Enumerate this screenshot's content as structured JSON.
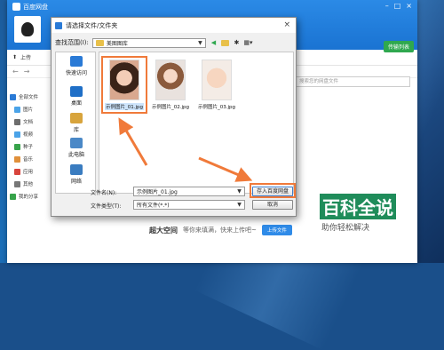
{
  "app": {
    "title": "百度网盘",
    "upload_label": "上传",
    "search_placeholder": "搜索您的网盘文件",
    "side_tag": "传输列表",
    "sidebar": [
      {
        "label": "全部文件",
        "color": "#2a7ad6",
        "sub": false
      },
      {
        "label": "图片",
        "color": "#4aa3e8",
        "sub": true
      },
      {
        "label": "文档",
        "color": "#6d6d6d",
        "sub": true
      },
      {
        "label": "视频",
        "color": "#4aa3e8",
        "sub": true
      },
      {
        "label": "种子",
        "color": "#37a34a",
        "sub": true
      },
      {
        "label": "音乐",
        "color": "#e0903a",
        "sub": true
      },
      {
        "label": "应用",
        "color": "#d8443c",
        "sub": true
      },
      {
        "label": "其他",
        "color": "#777777",
        "sub": true
      },
      {
        "label": "我的分享",
        "color": "#37a34a",
        "sub": false
      }
    ],
    "bottom_bold": "超大空间",
    "bottom_text": "等你来填满，快来上传吧~",
    "bottom_button": "上传文件"
  },
  "dialog": {
    "title": "请选择文件/文件夹",
    "lookin_label": "查找范围(I):",
    "lookin_value": "美图图库",
    "places": [
      {
        "label": "快速访问",
        "color": "#2a7ad6"
      },
      {
        "label": "桌面",
        "color": "#1f6fc7"
      },
      {
        "label": "库",
        "color": "#d8a43c"
      },
      {
        "label": "此电脑",
        "color": "#4a88c7"
      },
      {
        "label": "网络",
        "color": "#3a7cc0"
      }
    ],
    "files": [
      {
        "name": "示例图片_01.jpg",
        "selected": true
      },
      {
        "name": "示例图片_02.jpg",
        "selected": false
      },
      {
        "name": "示例图片_03.jpg",
        "selected": false
      }
    ],
    "filename_label": "文件名(N):",
    "filename_value": "示例图片_01.jpg",
    "filetype_label": "文件类型(T):",
    "filetype_value": "所有文件(*.*)",
    "save_button": "存入百度网盘",
    "cancel_button": "取消"
  },
  "watermark": {
    "main": "百科全说",
    "sub": "助你轻松解决"
  },
  "colors": {
    "highlight": "#f07a3a",
    "brand": "#2a7ad6"
  }
}
